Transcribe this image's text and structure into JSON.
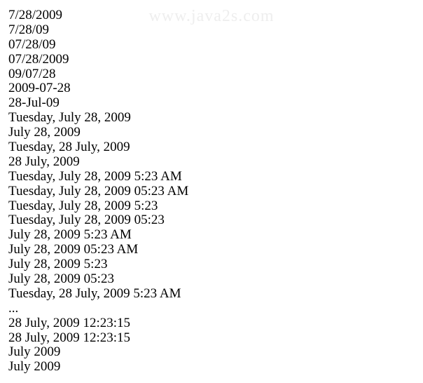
{
  "watermark": "www.java2s.com",
  "lines": [
    "7/28/2009",
    "7/28/09",
    "07/28/09",
    "07/28/2009",
    "09/07/28",
    "2009-07-28",
    "28-Jul-09",
    "Tuesday, July 28, 2009",
    "July 28, 2009",
    "Tuesday, 28 July, 2009",
    "28 July, 2009",
    "Tuesday, July 28, 2009 5:23 AM",
    "Tuesday, July 28, 2009 05:23 AM",
    "Tuesday, July 28, 2009 5:23",
    "Tuesday, July 28, 2009 05:23",
    "July 28, 2009 5:23 AM",
    "July 28, 2009 05:23 AM",
    "July 28, 2009 5:23",
    "July 28, 2009 05:23",
    "Tuesday, 28 July, 2009 5:23 AM",
    "...",
    "28 July, 2009 12:23:15",
    "28 July, 2009 12:23:15",
    "July 2009",
    "July 2009"
  ]
}
